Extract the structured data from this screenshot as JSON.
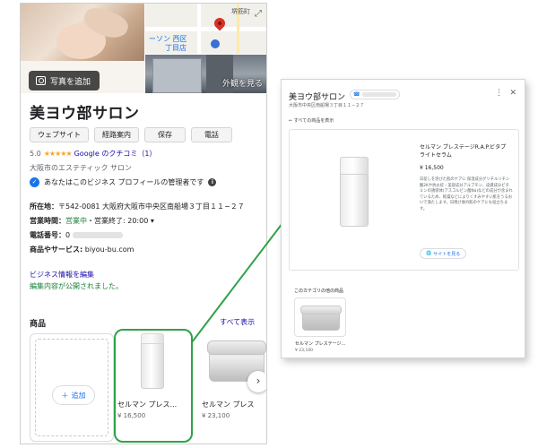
{
  "left": {
    "add_photo": "写真を追加",
    "exterior": "外観を見る",
    "map_labels": [
      "堺筋町",
      "ーソン 西区",
      "丁目店"
    ],
    "title": "美ヨウ部サロン",
    "actions": [
      "ウェブサイト",
      "経路案内",
      "保存",
      "電話"
    ],
    "rating": {
      "value": "5.0",
      "stars": "★★★★★",
      "link": "Google のクチコミ（1）"
    },
    "category": "大阪市のエステティック サロン",
    "manager": "あなたはこのビジネス プロフィールの管理者です",
    "info": {
      "address_label": "所在地：",
      "address": "〒542-0081 大阪府大阪市中央区南船場３丁目１１−２７",
      "hours_label": "営業時間：",
      "hours_status": "営業中",
      "hours_detail": "・営業終了: 20:00 ▾",
      "phone_label": "電話番号：",
      "phone_prefix": "0",
      "products_label": "商品やサービス:",
      "products_value": "biyou-bu.com"
    },
    "edit_link": "ビジネス情報を編集",
    "edit_note": "編集内容が公開されました。",
    "products_heading": "商品",
    "show_all": "すべて表示",
    "add_label": "追加",
    "products": [
      {
        "name": "セルマン プレス...",
        "price": "¥ 16,500"
      },
      {
        "name": "セルマン プレス",
        "price": "¥ 23,100"
      }
    ]
  },
  "right": {
    "title": "美ヨウ部サロン",
    "address": "大阪市中央区南船場３丁目１１−２７",
    "back": "← すべての商品を表示",
    "product_name": "セルマン プレステージR.A.P.ビタプライトセラム",
    "product_price": "¥ 16,500",
    "description": "日差しを浴びた肌のケアに 保湿成分グリチルリチン酸2Kや抗炎症・美容成分アルブチン、皮膚成分ビタミンの誘導体(アスコルビン酸Na)などの成分が含まれているため、乾燥などによりくすみやすい肌をうるおいで満たします。日焼け後の肌のケアにも役立ちます。",
    "site_button": "サイトを見る",
    "other_label": "このカテゴリの他の商品",
    "other_name": "セルマン プレステージ...",
    "other_price": "¥ 23,100"
  },
  "colors": {
    "highlight": "#2fa24a",
    "link": "#1a0dab",
    "open_status": "#188038",
    "star": "#f5a623"
  }
}
